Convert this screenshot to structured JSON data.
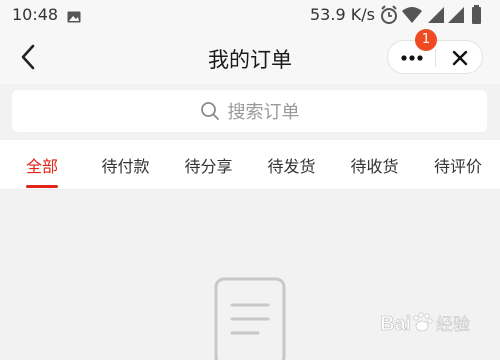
{
  "status_bar": {
    "time": "10:48",
    "net_speed": "53.9 K/s"
  },
  "header": {
    "title": "我的订单",
    "notification_count": "1"
  },
  "search": {
    "placeholder": "搜索订单"
  },
  "tabs": [
    {
      "label": "全部",
      "active": true
    },
    {
      "label": "待付款",
      "active": false
    },
    {
      "label": "待分享",
      "active": false
    },
    {
      "label": "待发货",
      "active": false
    },
    {
      "label": "待收货",
      "active": false
    },
    {
      "label": "待评价",
      "active": false
    }
  ],
  "watermark": {
    "text": "Baidu经验"
  },
  "colors": {
    "accent": "#e2231a",
    "badge": "#f04a22"
  }
}
